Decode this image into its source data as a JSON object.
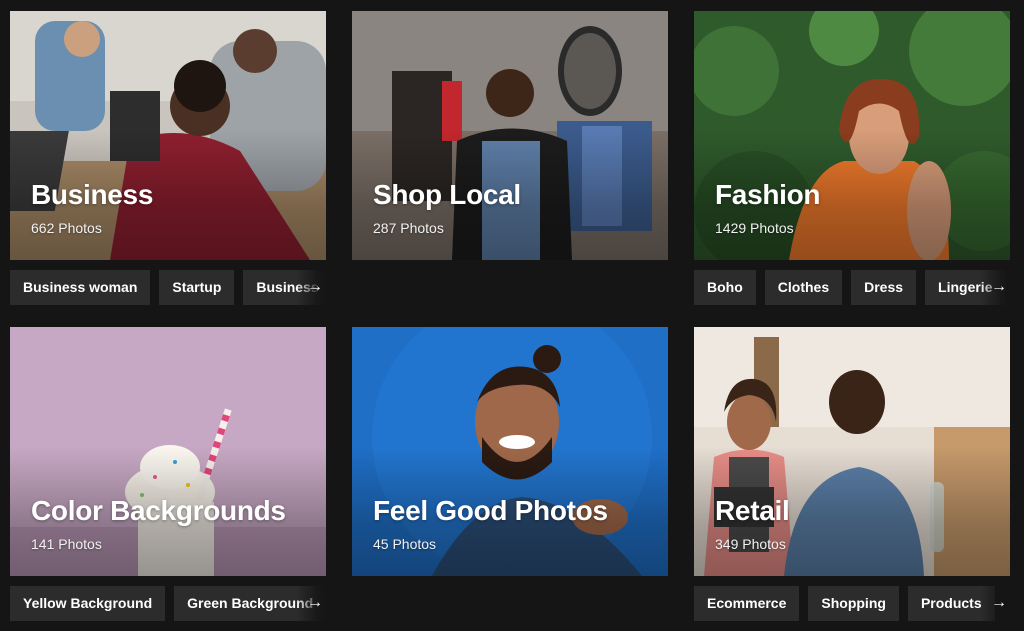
{
  "colors": {
    "page_bg": "#151515",
    "tag_bg": "#2c2c2c",
    "text": "#ffffff"
  },
  "arrow_icon": "→",
  "collections": [
    {
      "title": "Business",
      "count": "662 Photos",
      "tags": [
        "Business woman",
        "Startup",
        "Business"
      ]
    },
    {
      "title": "Shop Local",
      "count": "287 Photos",
      "tags": []
    },
    {
      "title": "Fashion",
      "count": "1429 Photos",
      "tags": [
        "Boho",
        "Clothes",
        "Dress",
        "Lingerie"
      ]
    },
    {
      "title": "Color Backgrounds",
      "count": "141 Photos",
      "tags": [
        "Yellow Background",
        "Green Background"
      ]
    },
    {
      "title": "Feel Good Photos",
      "count": "45 Photos",
      "tags": []
    },
    {
      "title": "Retail",
      "count": "349 Photos",
      "tags": [
        "Ecommerce",
        "Shopping",
        "Products"
      ]
    }
  ]
}
